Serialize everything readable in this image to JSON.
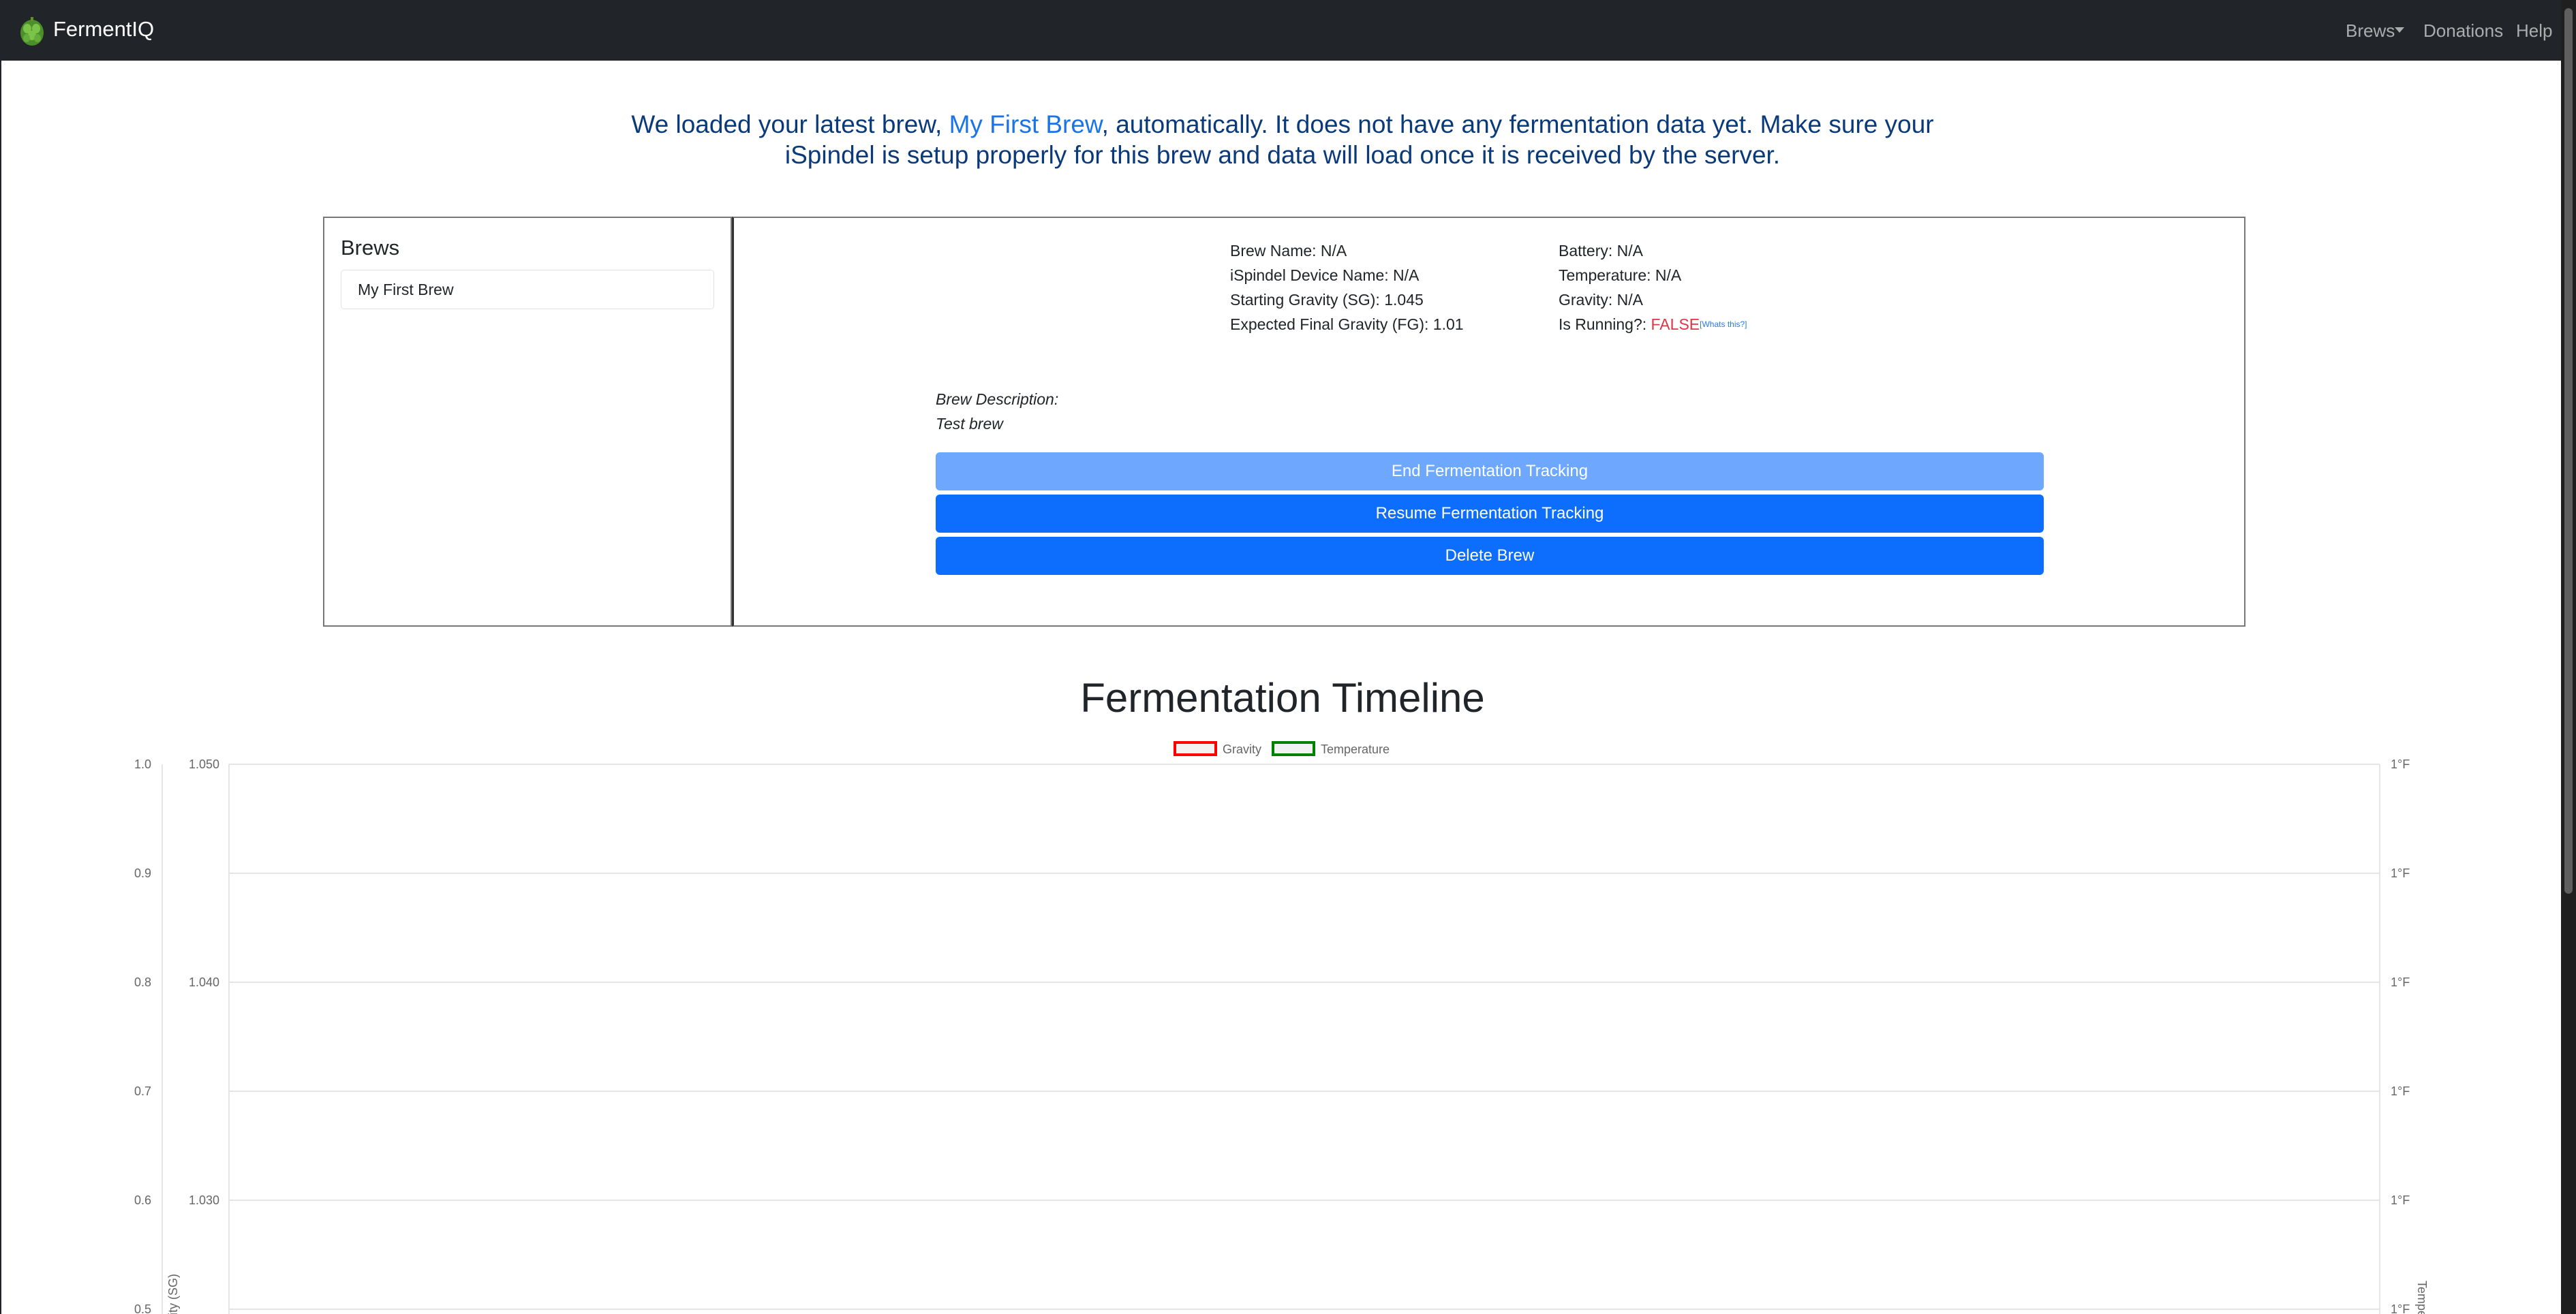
{
  "navbar": {
    "brand": "FermentIQ",
    "brews": "Brews",
    "donations": "Donations",
    "help": "Help"
  },
  "alert": {
    "before": "We loaded your latest brew, ",
    "brew_link": "My First Brew",
    "after": ", automatically. It does not have any fermentation data yet. Make sure your iSpindel is setup properly for this brew and data will load once it is received by the server."
  },
  "brews_panel": {
    "title": "Brews",
    "items": [
      "My First Brew"
    ]
  },
  "details": {
    "brew_name": "Brew Name: N/A",
    "device_name": "iSpindel Device Name: N/A",
    "starting_gravity": "Starting Gravity (SG): 1.045",
    "final_gravity": "Expected Final Gravity (FG): 1.01",
    "battery": "Battery: N/A",
    "temperature": "Temperature: N/A",
    "gravity": "Gravity: N/A",
    "is_running_label": "Is Running?: ",
    "is_running_value": "FALSE",
    "whats_this": "[Whats this?]",
    "description_label": "Brew Description:",
    "description_value": "Test brew"
  },
  "buttons": {
    "end": "End Fermentation Tracking",
    "resume": "Resume Fermentation Tracking",
    "delete": "Delete Brew"
  },
  "colors": {
    "gravity": "#ff0000",
    "temperature": "#008000",
    "primary": "#0d6efd",
    "navbar": "#212529"
  },
  "chart_data": {
    "type": "line",
    "title": "Fermentation Timeline",
    "legend": [
      "Gravity",
      "Temperature"
    ],
    "legend_placement": "top-center",
    "grid": true,
    "series": [],
    "y_left_outer_ticks": [
      "1.0",
      "0.9",
      "0.8",
      "0.7",
      "0.6",
      "0.5"
    ],
    "y_left_gravity_ticks": [
      "1.050",
      "1.040",
      "1.030"
    ],
    "y_left_label": "Gravity (SG)",
    "y_right_ticks": [
      "1°F",
      "1°F",
      "1°F",
      "1°F",
      "1°F",
      "1°F"
    ],
    "y_right_label": "Temperature"
  }
}
